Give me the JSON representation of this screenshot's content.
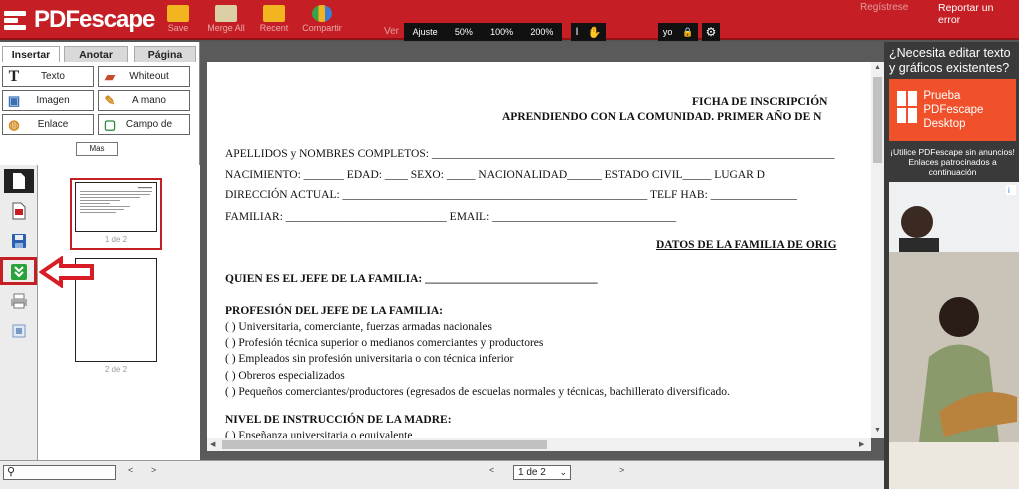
{
  "app": {
    "logo_text": "PDFescape",
    "toolbar": [
      {
        "label": "Save",
        "icon": "folder-save-icon"
      },
      {
        "label": "Merge All",
        "icon": "folder-merge-icon"
      },
      {
        "label": "Recent",
        "icon": "folder-recent-icon"
      },
      {
        "label": "Compartir",
        "icon": "people-share-icon"
      }
    ],
    "view_label": "Ver",
    "zoom_options": [
      "Ajuste",
      "50%",
      "100%",
      "200%"
    ],
    "lock_label": "yo",
    "registro_label": "Regístrese",
    "report_label": "Reportar un error"
  },
  "left": {
    "tabs": [
      "Insertar",
      "Anotar",
      "Página"
    ],
    "tools": [
      {
        "label": "Texto",
        "icon": "text-tool-icon"
      },
      {
        "label": "Whiteout",
        "icon": "whiteout-tool-icon"
      },
      {
        "label": "Imagen",
        "icon": "image-tool-icon"
      },
      {
        "label": "A mano",
        "icon": "pencil-tool-icon"
      },
      {
        "label": "Enlace",
        "icon": "link-tool-icon"
      },
      {
        "label": "Campo de",
        "icon": "form-field-tool-icon"
      }
    ],
    "more_label": "Mas",
    "thumbs": [
      {
        "label": "1 de 2"
      },
      {
        "label": "2 de 2"
      }
    ]
  },
  "document": {
    "title1": "FICHA DE INSCRIPCIÓN",
    "title2": "APRENDIENDO CON LA COMUNIDAD. PRIMER AÑO DE N",
    "lines": [
      "APELLIDOS y NOMBRES COMPLETOS: ______________________________________________________________________",
      "NACIMIENTO: _______      EDAD: ____    SEXO: _____    NACIONALIDAD______ ESTADO CIVIL_____          LUGAR D",
      "DIRECCIÓN ACTUAL: _____________________________________________________     TELF HAB: _______________",
      "FAMILIAR: ____________________________         EMAIL: ________________________________"
    ],
    "section_family": "DATOS DE LA FAMILIA DE ORIG",
    "jefe_line": "QUIEN ES EL JEFE DE LA FAMILIA: ______________________________",
    "profesion_heading": "PROFESIÓN DEL JEFE DE LA FAMILIA:",
    "profesion_options": [
      "(   )        Universitaria, comerciante, fuerzas armadas nacionales",
      "(   )        Profesión técnica superior o medianos comerciantes y productores",
      "(   )     Empleados sin profesión universitaria o con técnica inferior",
      "(   )     Obreros especializados",
      "(   )        Pequeños comerciantes/productores (egresados de escuelas normales y técnicas, bachillerato   diversificado."
    ],
    "instruccion_heading": "NIVEL DE INSTRUCCIÓN DE LA MADRE:",
    "instruccion_first": "(   )        Enseñanza universitaria o equivalente"
  },
  "ad": {
    "question": "¿Necesita editar texto y gráficos existentes?",
    "cta": "Prueba PDFescape Desktop",
    "small": "¡Utilice PDFescape sin anuncios! Enlaces patrocinados a continuación"
  },
  "bottom": {
    "page_select": "1 de 2"
  },
  "colors": {
    "brand_red": "#c51f25",
    "ad_orange": "#f0502a",
    "highlight_green": "#2aa33a"
  }
}
